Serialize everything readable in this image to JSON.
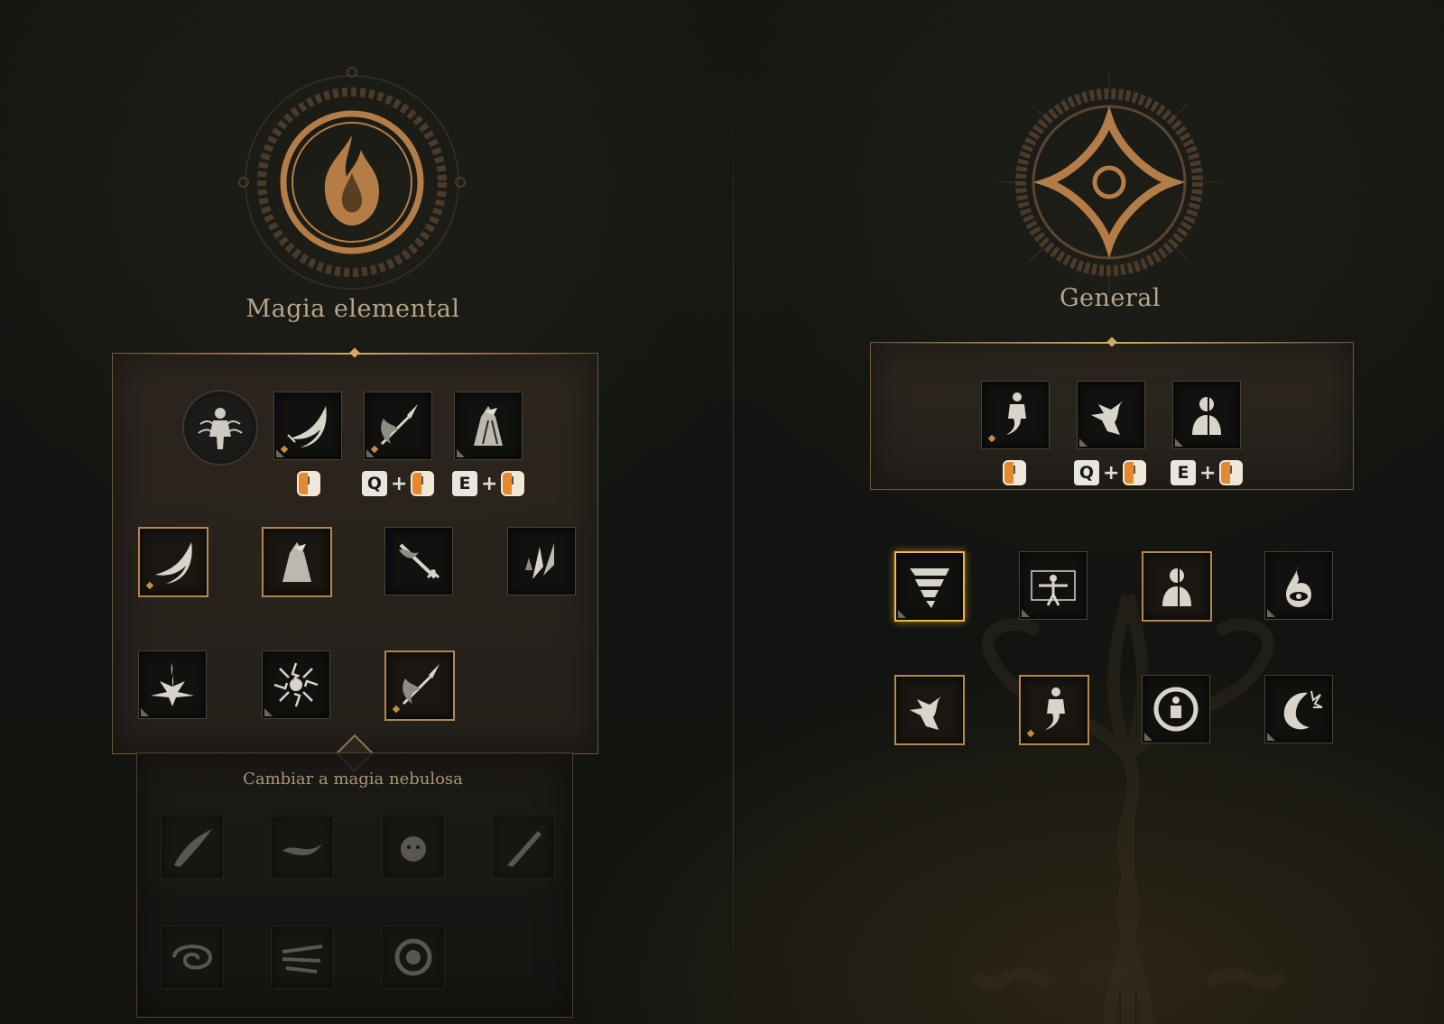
{
  "left": {
    "title": "Magia elemental",
    "emblem": "fire-emblem-icon",
    "top_row": {
      "portrait": "caster-portrait-icon",
      "slots": [
        {
          "icon": "fire-wave-icon",
          "binding": {
            "keys": [],
            "mouse": "left-click"
          }
        },
        {
          "icon": "flaming-spear-icon",
          "binding": {
            "keys": [
              "Q"
            ],
            "mouse": "left-click"
          }
        },
        {
          "icon": "cloaked-mage-icon",
          "binding": {
            "keys": [
              "E"
            ],
            "mouse": "left-click"
          }
        }
      ]
    },
    "skills": [
      {
        "icon": "fire-wave-icon",
        "state": "equipped"
      },
      {
        "icon": "cloaked-mage-icon",
        "state": "equipped"
      },
      {
        "icon": "flaming-sword-icon",
        "state": "available"
      },
      {
        "icon": "ice-shards-icon",
        "state": "available"
      },
      {
        "icon": "fire-burst-icon",
        "state": "available"
      },
      {
        "icon": "lightning-orb-icon",
        "state": "available"
      },
      {
        "icon": "flaming-spear-icon",
        "state": "equipped"
      }
    ],
    "switch_label": "Cambiar a magia nebulosa",
    "nebula_skills": [
      {
        "icon": "shadow-slash-icon"
      },
      {
        "icon": "shadow-swirl-icon"
      },
      {
        "icon": "shadow-creature-icon"
      },
      {
        "icon": "shadow-blade-icon"
      },
      {
        "icon": "mist-vortex-icon"
      },
      {
        "icon": "mist-rush-icon"
      },
      {
        "icon": "dark-orb-icon"
      }
    ]
  },
  "right": {
    "title": "General",
    "emblem": "celtic-knot-emblem-icon",
    "top_row": {
      "slots": [
        {
          "icon": "spirit-figure-icon",
          "binding": {
            "keys": [],
            "mouse": "left-click"
          }
        },
        {
          "icon": "wind-dash-icon",
          "binding": {
            "keys": [
              "Q"
            ],
            "mouse": "left-click"
          }
        },
        {
          "icon": "split-bust-icon",
          "binding": {
            "keys": [
              "E"
            ],
            "mouse": "left-click"
          }
        }
      ]
    },
    "skills": [
      {
        "icon": "tornado-icon",
        "state": "selected"
      },
      {
        "icon": "binding-pose-icon",
        "state": "available"
      },
      {
        "icon": "split-bust-icon",
        "state": "equipped"
      },
      {
        "icon": "flame-eye-icon",
        "state": "available"
      },
      {
        "icon": "wind-dash-icon",
        "state": "equipped"
      },
      {
        "icon": "spirit-figure-icon",
        "state": "equipped"
      },
      {
        "icon": "warrior-ring-icon",
        "state": "available"
      },
      {
        "icon": "moon-burst-icon",
        "state": "available"
      }
    ]
  },
  "colors": {
    "accent_gold": "#d6a862",
    "selected_border": "#f0b83c",
    "mouse_button": "#e6892e"
  }
}
